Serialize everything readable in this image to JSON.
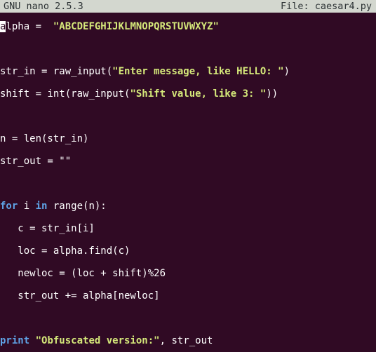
{
  "window": {
    "app_title": "GNU nano 2.5.3",
    "file_label": "File: caesar4.py"
  },
  "code": {
    "l1": {
      "cursor_char": "a",
      "rest": "lpha =  ",
      "string": "\"ABCDEFGHIJKLMNOPQRSTUVWXYZ\""
    },
    "l2": {
      "pre": "str_in = raw_input(",
      "string": "\"Enter message, like HELLO: \"",
      "post": ")"
    },
    "l3": {
      "pre": "shift = int(raw_input(",
      "string": "\"Shift value, like 3: \"",
      "post": "))"
    },
    "l4": {
      "text": "n = len(str_in)"
    },
    "l5": {
      "pre": "str_out = ",
      "string": "\"\""
    },
    "l6": {
      "kw1": "for",
      "mid1": " i ",
      "kw2": "in",
      "mid2": " range(n):"
    },
    "l7": {
      "text": "   c = str_in[i]"
    },
    "l8": {
      "text": "   loc = alpha.find(c)"
    },
    "l9": {
      "text": "   newloc = (loc + shift)%26"
    },
    "l10": {
      "text": "   str_out += alpha[newloc]"
    },
    "l11": {
      "kw": "print",
      "space": " ",
      "string": "\"Obfuscated version:\"",
      "post": ", str_out"
    }
  }
}
